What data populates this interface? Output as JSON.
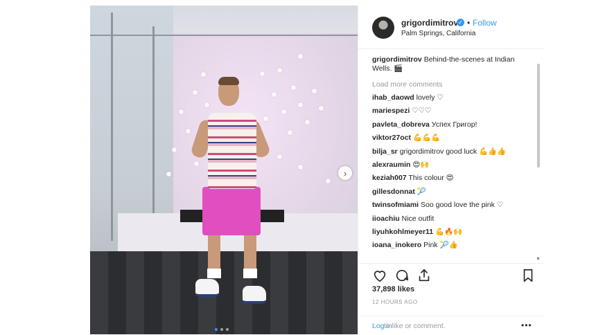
{
  "post": {
    "username": "grigordimitrov",
    "verified_icon": "verified-badge-icon",
    "separator": "•",
    "follow_label": "Follow",
    "location": "Palm Springs, California",
    "caption_user": "grigordimitrov",
    "caption_text": "Behind-the-scenes at Indian Wells. 🎬",
    "load_more": "Load more comments",
    "comments": [
      {
        "user": "ihab_daowd",
        "text": "lovely ♡"
      },
      {
        "user": "mariespezi",
        "text": "♡♡♡"
      },
      {
        "user": "pavleta_dobreva",
        "text": "Успех Григор!"
      },
      {
        "user": "viktor27oct",
        "text": "💪💪💪"
      },
      {
        "user": "bilja_sr",
        "text": "grigordimitrov good luck 💪👍👍"
      },
      {
        "user": "alexraumin",
        "text": "😍🙌"
      },
      {
        "user": "keziah007",
        "text": "This colour 😍"
      },
      {
        "user": "gillesdonnat",
        "text": "🎾"
      },
      {
        "user": "twinsofmiami",
        "text": "Soo good love the pink ♡"
      },
      {
        "user": "iioachiu",
        "text": "Nice outfit"
      },
      {
        "user": "liyuhkohlmeyer11",
        "text": "💪🔥🙌"
      },
      {
        "user": "ioana_inokero",
        "text": "Pink 🎾👍"
      }
    ],
    "likes": "37,898 likes",
    "time": "12 HOURS AGO",
    "login_link": "Log in",
    "login_rest": "to like or comment.",
    "more_label": "•••",
    "next_label": "›"
  },
  "icons": {
    "heart": "heart-icon",
    "comment": "comment-icon",
    "share": "share-icon",
    "bookmark": "bookmark-icon"
  },
  "colors": {
    "link": "#3897f0",
    "text": "#262626",
    "muted": "#999999",
    "shorts": "#e04ec0"
  },
  "carousel": {
    "total": 3,
    "active": 1
  }
}
